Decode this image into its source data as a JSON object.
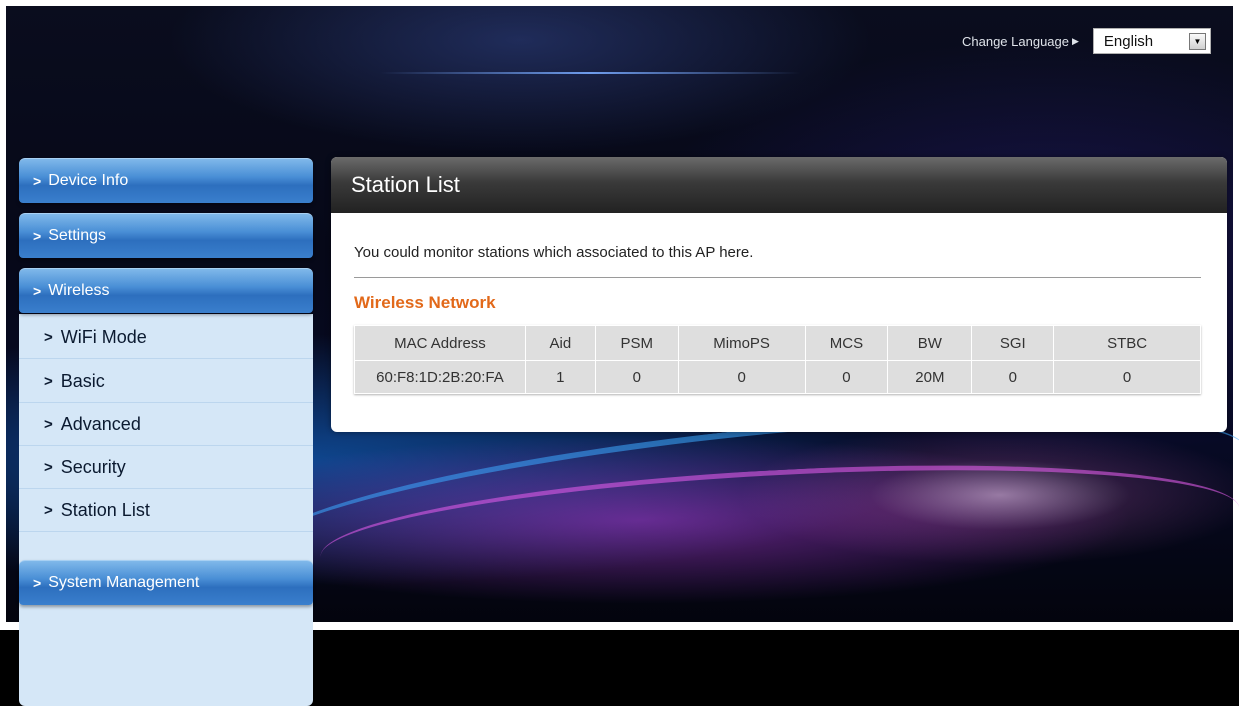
{
  "header": {
    "change_language_label": "Change Language",
    "language_selected": "English"
  },
  "sidebar": {
    "items": [
      {
        "label": "Device Info"
      },
      {
        "label": "Settings"
      },
      {
        "label": "Wireless"
      },
      {
        "label": "System Management"
      }
    ],
    "wireless_subitems": [
      {
        "label": "WiFi Mode"
      },
      {
        "label": "Basic"
      },
      {
        "label": "Advanced"
      },
      {
        "label": "Security"
      },
      {
        "label": "Station List"
      }
    ]
  },
  "main": {
    "title": "Station List",
    "description": "You could monitor stations which associated to this AP here.",
    "section_title": "Wireless Network",
    "table": {
      "columns": [
        "MAC Address",
        "Aid",
        "PSM",
        "MimoPS",
        "MCS",
        "BW",
        "SGI",
        "STBC"
      ],
      "rows": [
        [
          "60:F8:1D:2B:20:FA",
          "1",
          "0",
          "0",
          "0",
          "20M",
          "0",
          "0"
        ]
      ]
    }
  }
}
